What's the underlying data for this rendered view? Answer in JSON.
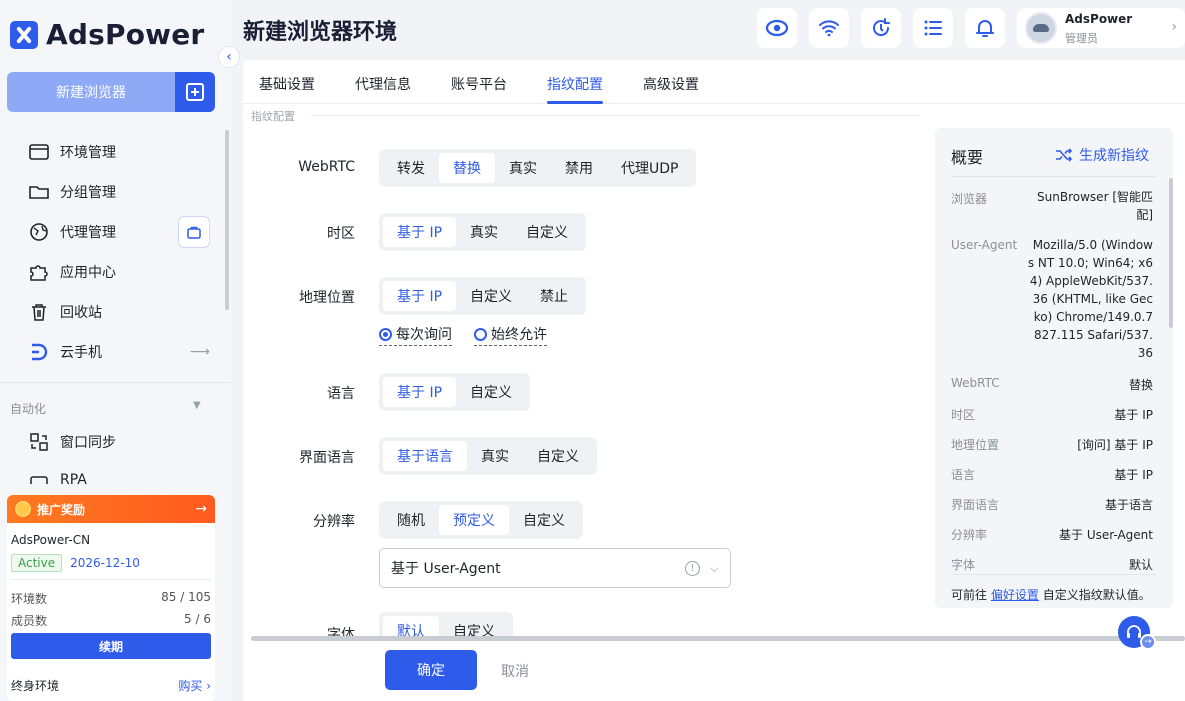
{
  "app": {
    "logo_text": "AdsPower",
    "brand_color": "#2f5bea"
  },
  "sidebar": {
    "new_browser_label": "新建浏览器",
    "items": [
      {
        "label": "环境管理",
        "icon": "browser-window-icon"
      },
      {
        "label": "分组管理",
        "icon": "folder-icon"
      },
      {
        "label": "代理管理",
        "icon": "proxy-globe-icon"
      },
      {
        "label": "应用中心",
        "icon": "puzzle-icon"
      },
      {
        "label": "回收站",
        "icon": "trash-icon"
      },
      {
        "label": "云手机",
        "icon": "cloud-phone-icon"
      }
    ],
    "section_automation": "自动化",
    "auto_items": [
      {
        "label": "窗口同步",
        "icon": "window-sync-icon"
      },
      {
        "label": "RPA",
        "icon": "rpa-icon"
      }
    ]
  },
  "promo": {
    "title": "推广奖励",
    "arrow": "→",
    "account": "AdsPower-CN",
    "status": "Active",
    "expiry": "2026-12-10",
    "env_label": "环境数",
    "env_value": "85 / 105",
    "member_label": "成员数",
    "member_value": "5 / 6",
    "renew_label": "续期",
    "lifetime_label": "终身环境",
    "buy_label": "购买 ›"
  },
  "header": {
    "title": "新建浏览器环境",
    "user_name": "AdsPower",
    "user_role": "管理员"
  },
  "tabs": [
    {
      "label": "基础设置"
    },
    {
      "label": "代理信息"
    },
    {
      "label": "账号平台"
    },
    {
      "label": "指纹配置"
    },
    {
      "label": "高级设置"
    }
  ],
  "form": {
    "section_title": "指纹配置",
    "webrtc": {
      "label": "WebRTC",
      "options": [
        "转发",
        "替换",
        "真实",
        "禁用",
        "代理UDP"
      ],
      "selected": 1
    },
    "timezone": {
      "label": "时区",
      "options": [
        "基于 IP",
        "真实",
        "自定义"
      ],
      "selected": 0
    },
    "geo": {
      "label": "地理位置",
      "options": [
        "基于 IP",
        "自定义",
        "禁止"
      ],
      "selected": 0,
      "radio_ask": "每次询问",
      "radio_allow": "始终允许"
    },
    "language": {
      "label": "语言",
      "options": [
        "基于 IP",
        "自定义"
      ],
      "selected": 0
    },
    "ui_language": {
      "label": "界面语言",
      "options": [
        "基于语言",
        "真实",
        "自定义"
      ],
      "selected": 0
    },
    "resolution": {
      "label": "分辨率",
      "options": [
        "随机",
        "预定义",
        "自定义"
      ],
      "selected": 1,
      "select_value": "基于 User-Agent"
    },
    "font": {
      "label": "字体",
      "options": [
        "默认",
        "自定义"
      ],
      "selected": 0
    }
  },
  "summary": {
    "title": "概要",
    "generate_label": "生成新指纹",
    "browser_k": "浏览器",
    "browser_v": "SunBrowser [智能匹配]",
    "ua_k": "User-Agent",
    "ua_v": "Mozilla/5.0 (Windows NT 10.0; Win64; x64) AppleWebKit/537.36 (KHTML, like Gecko) Chrome/149.0.7827.115 Safari/537.36",
    "rows": [
      {
        "k": "WebRTC",
        "v": "替换"
      },
      {
        "k": "时区",
        "v": "基于 IP"
      },
      {
        "k": "地理位置",
        "v": "[询问] 基于 IP"
      },
      {
        "k": "语言",
        "v": "基于 IP"
      },
      {
        "k": "界面语言",
        "v": "基于语言"
      },
      {
        "k": "分辨率",
        "v": "基于 User-Agent"
      },
      {
        "k": "字体",
        "v": "默认"
      }
    ],
    "foot_prefix": "可前往",
    "foot_link": "偏好设置",
    "foot_suffix": "自定义指纹默认值。"
  },
  "footer": {
    "confirm_label": "确定",
    "cancel_label": "取消"
  }
}
